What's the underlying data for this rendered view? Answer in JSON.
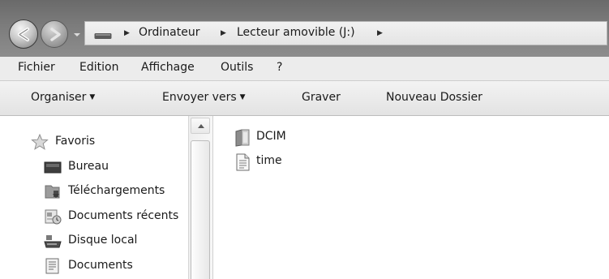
{
  "address_bar": {
    "breadcrumbs": [
      "Ordinateur",
      "Lecteur amovible (J:)"
    ]
  },
  "menu": {
    "items": [
      "Fichier",
      "Edition",
      "Affichage",
      "Outils",
      "?"
    ]
  },
  "command_bar": {
    "organize": "Organiser",
    "send_to": "Envoyer vers",
    "burn": "Graver",
    "new_folder": "Nouveau Dossier"
  },
  "navigation": {
    "favorites_label": "Favoris",
    "items": [
      {
        "label": "Bureau",
        "icon": "desktop-icon"
      },
      {
        "label": "Téléchargements",
        "icon": "downloads-icon"
      },
      {
        "label": "Documents récents",
        "icon": "recent-documents-icon"
      },
      {
        "label": "Disque local",
        "icon": "local-disk-icon"
      },
      {
        "label": "Documents",
        "icon": "documents-icon"
      }
    ]
  },
  "files": [
    {
      "name": "DCIM",
      "icon": "folder-icon"
    },
    {
      "name": "time",
      "icon": "text-file-icon"
    }
  ]
}
